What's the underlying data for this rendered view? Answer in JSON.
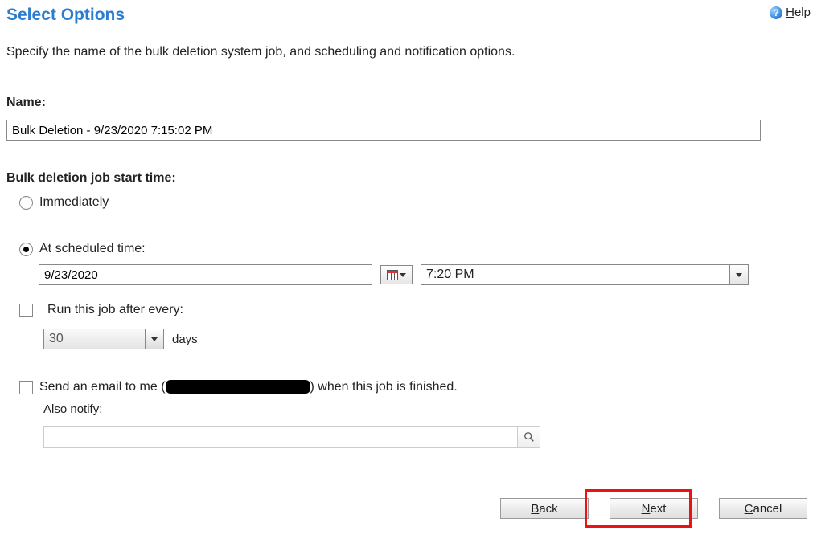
{
  "header": {
    "title": "Select Options",
    "help": "Help"
  },
  "description": "Specify the name of the bulk deletion system job, and scheduling and notification options.",
  "name_section": {
    "label": "Name:",
    "value": "Bulk Deletion - 9/23/2020 7:15:02 PM"
  },
  "start_time_section": {
    "label": "Bulk deletion job start time:",
    "immediately": "Immediately",
    "scheduled": "At scheduled time:",
    "date_value": "9/23/2020",
    "time_value": "7:20 PM"
  },
  "recurrence": {
    "run_after_label": "Run this job after every:",
    "interval_value": "30",
    "unit": "days"
  },
  "notification": {
    "prefix": "Send an email to me (",
    "suffix": ") when this job is finished.",
    "also_notify": "Also notify:"
  },
  "footer": {
    "back": "Back",
    "next": "Next",
    "cancel": "Cancel"
  }
}
